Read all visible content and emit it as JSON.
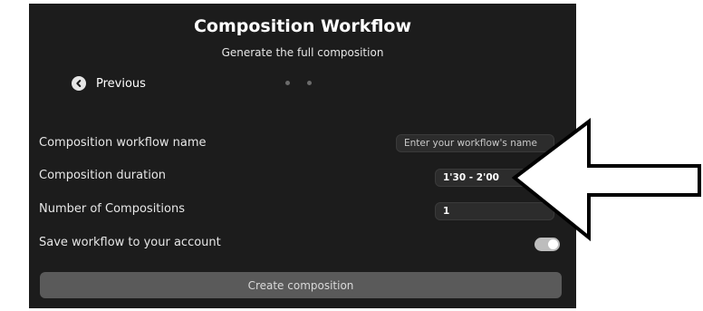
{
  "header": {
    "title": "Composition Workflow",
    "subtitle": "Generate the full composition"
  },
  "nav": {
    "previous_label": "Previous",
    "step_dots": 2
  },
  "form": {
    "name_label": "Composition workflow name",
    "name_placeholder": "Enter your workflow's name",
    "duration_label": "Composition duration",
    "duration_value": "1'30 - 2'00",
    "count_label": "Number of Compositions",
    "count_value": "1",
    "save_label": "Save workflow to your account",
    "save_enabled": true
  },
  "actions": {
    "create_label": "Create composition"
  },
  "annotation": {
    "arrow_target": "composition-duration-field"
  },
  "colors": {
    "panel_bg": "#1c1c1c",
    "field_bg": "#2c2c2c",
    "button_bg": "#5a5a5a",
    "toggle_on": "#bdbdbd"
  }
}
